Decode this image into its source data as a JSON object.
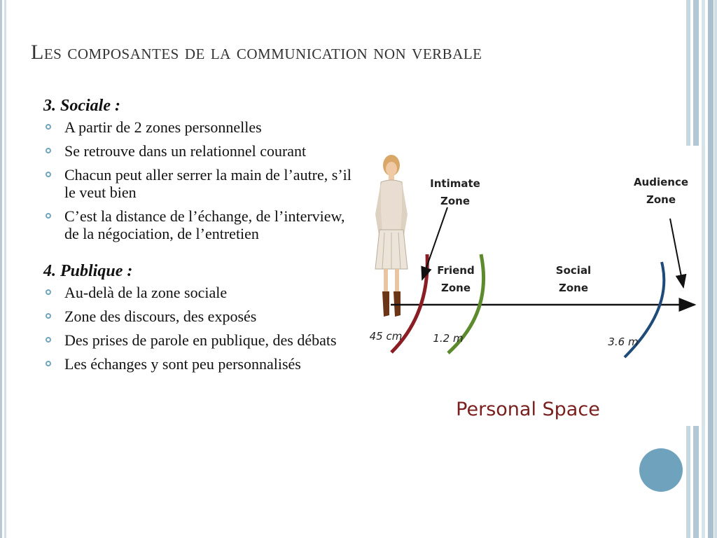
{
  "slide": {
    "title": "Les composantes de la communication non verbale"
  },
  "sections": [
    {
      "heading": "3. Sociale :",
      "bullets": [
        "A partir de 2 zones personnelles",
        "Se retrouve dans un relationnel courant",
        "Chacun peut aller serrer la main de l’autre, s’il le veut bien",
        "C’est la distance de l’échange, de l’interview, de la négociation, de l’entretien"
      ]
    },
    {
      "heading": "4. Publique :",
      "bullets": [
        "Au-delà de la zone sociale",
        "Zone des discours, des exposés",
        "Des prises de parole en publique, des débats",
        "Les échanges y sont peu personnalisés"
      ]
    }
  ],
  "diagram": {
    "title": "Personal Space",
    "zones": {
      "intimate_line1": "Intimate",
      "intimate_line2": "Zone",
      "friend_line1": "Friend",
      "friend_line2": "Zone",
      "social_line1": "Social",
      "social_line2": "Zone",
      "audience_line1": "Audience",
      "audience_line2": "Zone"
    },
    "distances": {
      "d1": "45 cm",
      "d2": "1.2 m",
      "d3": "3.6 m"
    },
    "colors": {
      "intimate_arc": "#8b1e24",
      "friend_arc": "#5c8a2c",
      "audience_arc": "#1f4b79",
      "title_text": "#7a1e1e"
    }
  }
}
